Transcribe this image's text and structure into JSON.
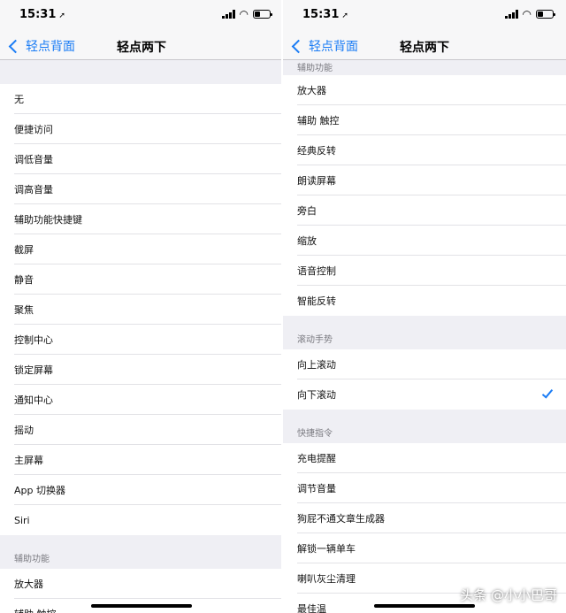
{
  "status_bar": {
    "time": "15:31",
    "location_glyph": "➚"
  },
  "accent_color": "#1a7cf5",
  "left": {
    "nav": {
      "back_label": "轻点背面",
      "title": "轻点两下"
    },
    "actions": [
      "无",
      "便捷访问",
      "调低音量",
      "调高音量",
      "辅助功能快捷键",
      "截屏",
      "静音",
      "聚焦",
      "控制中心",
      "锁定屏幕",
      "通知中心",
      "摇动",
      "主屏幕",
      "App 切换器",
      "Siri"
    ],
    "accessibility_header": "辅助功能",
    "accessibility_items": [
      "放大器",
      "辅助 触控"
    ]
  },
  "right": {
    "nav": {
      "back_label": "轻点背面",
      "title": "轻点两下"
    },
    "accessibility_header": "辅助功能",
    "accessibility_items": [
      "放大器",
      "辅助 触控",
      "经典反转",
      "朗读屏幕",
      "旁白",
      "缩放",
      "语音控制",
      "智能反转"
    ],
    "scroll_header": "滚动手势",
    "scroll_items": [
      "向上滚动",
      "向下滚动"
    ],
    "scroll_selected": "向下滚动",
    "shortcuts_header": "快捷指令",
    "shortcut_items": [
      "充电提醒",
      "调节音量",
      "狗屁不通文章生成器",
      "解锁一辆单车",
      "喇叭灰尘清理",
      "最佳温"
    ]
  },
  "watermark": "头条 @小小巴哥"
}
